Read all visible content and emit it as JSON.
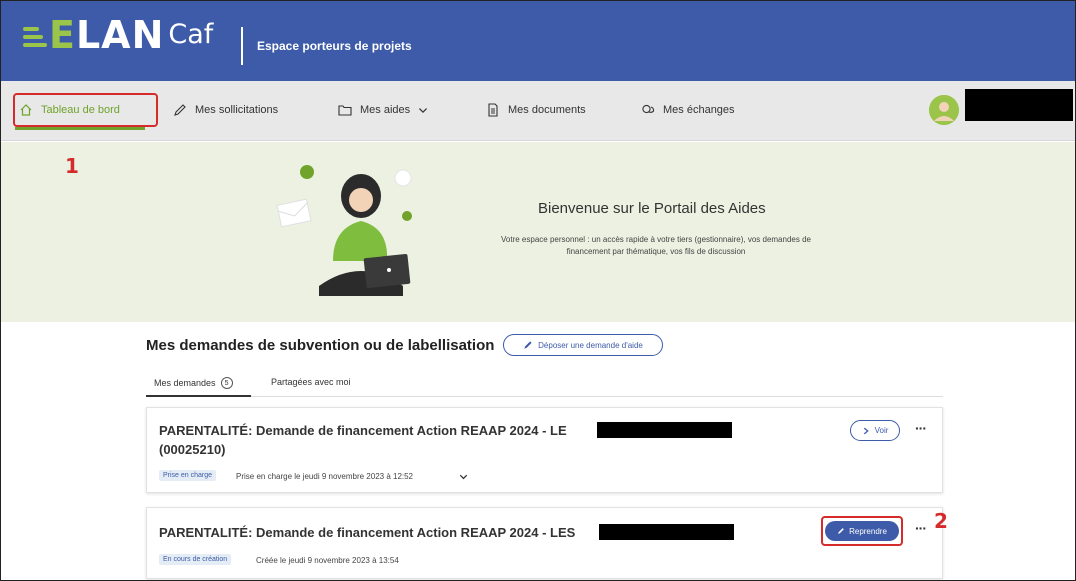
{
  "header": {
    "logo_main": "ELAN",
    "logo_sub": "Caf",
    "app_title": "Espace porteurs de projets",
    "brand_color": "#3d5ba8",
    "accent_color": "#9bc54a"
  },
  "nav": {
    "items": [
      {
        "label": "Tableau de bord",
        "icon": "home-icon",
        "active": true
      },
      {
        "label": "Mes sollicitations",
        "icon": "pencil-icon"
      },
      {
        "label": "Mes aides",
        "icon": "folder-icon",
        "has_dropdown": true
      },
      {
        "label": "Mes documents",
        "icon": "document-icon"
      },
      {
        "label": "Mes échanges",
        "icon": "chat-icon"
      }
    ]
  },
  "annotations": {
    "marker1": "1",
    "marker2": "2",
    "color": "#d62b2b"
  },
  "hero": {
    "title": "Bienvenue sur le Portail des Aides",
    "description": "Votre espace personnel : un accès rapide à votre tiers (gestionnaire), vos demandes de financement par thématique, vos fils de discussion"
  },
  "section": {
    "title": "Mes demandes de subvention ou de labellisation",
    "deposit_button": "Déposer une demande d'aide",
    "tabs": [
      {
        "label": "Mes demandes",
        "count": "5",
        "active": true
      },
      {
        "label": "Partagées avec moi"
      }
    ]
  },
  "requests": [
    {
      "title_line1": "PARENTALITÉ: Demande de financement Action REAAP 2024 - LE",
      "title_line2": "(00025210)",
      "badge": "Prise en charge",
      "status": "Prise en charge le jeudi 9 novembre 2023 à 12:52",
      "action": "Voir",
      "more": "···"
    },
    {
      "title_line1": "PARENTALITÉ: Demande de financement Action REAAP 2024 - LES",
      "badge": "En cours de création",
      "status": "Créée le jeudi 9 novembre 2023 à 13:54",
      "action": "Reprendre",
      "more": "···"
    }
  ]
}
